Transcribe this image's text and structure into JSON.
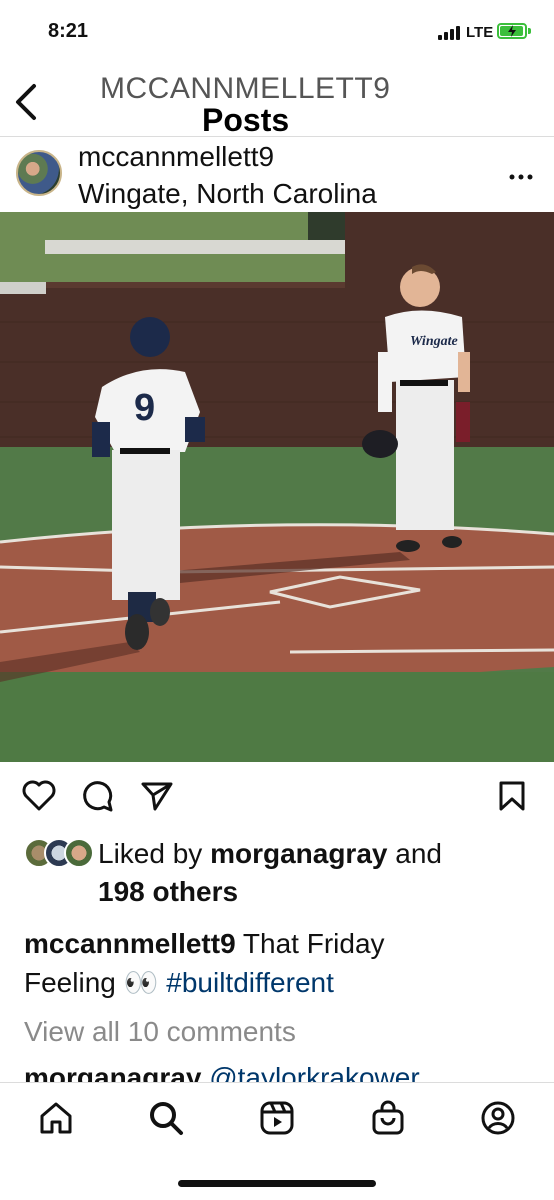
{
  "status_bar": {
    "time": "8:21",
    "network": "LTE",
    "icons": [
      "signal-icon",
      "battery-charging-icon"
    ]
  },
  "header": {
    "account": "MCCANNMELLETT9",
    "title": "Posts",
    "back_icon": "chevron-left-icon"
  },
  "post": {
    "username": "mccannmellett9",
    "location": "Wingate, North Carolina",
    "more_icon": "more-horizontal-icon",
    "photo": {
      "jersey_number": "9",
      "jersey_text": "Wingate"
    },
    "actions": [
      "heart-icon",
      "comment-icon",
      "share-icon",
      "bookmark-icon"
    ],
    "likes": {
      "prefix": "Liked by ",
      "user": "morganagray",
      "joiner": " and",
      "others": "198 others"
    },
    "caption": {
      "username": "mccannmellett9",
      "text_part1": " That Friday",
      "text_part2": "Feeling 👀 ",
      "hashtag": "#builtdifferent"
    },
    "view_comments": "View all 10 comments",
    "comment_preview": {
      "username": "morganagray",
      "mention": "@taylorkrakower"
    }
  },
  "tab_bar": {
    "tabs": [
      "home-icon",
      "search-icon",
      "reels-icon",
      "shop-icon",
      "profile-icon"
    ],
    "active": "search-icon"
  },
  "colors": {
    "accent_link": "#00376b",
    "battery": "#3bbf3b",
    "muted": "#8a8a8a"
  }
}
